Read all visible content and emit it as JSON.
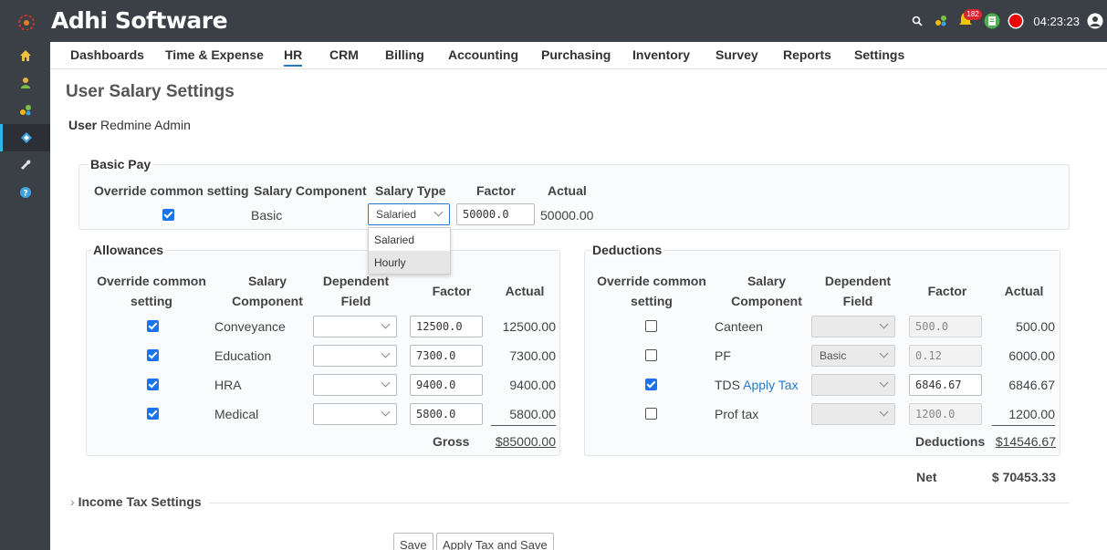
{
  "app": {
    "title": "Adhi Software",
    "notification_count": "182",
    "clock": "04:23:23"
  },
  "menu": [
    "Dashboards",
    "Time & Expense",
    "HR",
    "CRM",
    "Billing",
    "Accounting",
    "Purchasing",
    "Inventory",
    "Survey",
    "Reports",
    "Settings"
  ],
  "page": {
    "title": "User Salary Settings",
    "user_label": "User",
    "user_value": "Redmine Admin"
  },
  "basic_pay": {
    "legend": "Basic Pay",
    "headers": {
      "override": "Override common setting",
      "component": "Salary Component",
      "type": "Salary Type",
      "factor": "Factor",
      "actual": "Actual"
    },
    "row": {
      "checked": true,
      "component": "Basic",
      "salary_type": "Salaried",
      "factor": "50000.0",
      "actual": "50000.00"
    },
    "type_options": [
      "Salaried",
      "Hourly"
    ]
  },
  "allowances": {
    "legend": "Allowances",
    "headers": {
      "override_1": "Override common",
      "override_2": "setting",
      "component_1": "Salary",
      "component_2": "Component",
      "dep_1": "Dependent",
      "dep_2": "Field",
      "factor": "Factor",
      "actual": "Actual"
    },
    "rows": [
      {
        "checked": true,
        "component": "Conveyance",
        "factor": "12500.0",
        "actual": "12500.00"
      },
      {
        "checked": true,
        "component": "Education",
        "factor": "7300.0",
        "actual": "7300.00"
      },
      {
        "checked": true,
        "component": "HRA",
        "factor": "9400.0",
        "actual": "9400.00"
      },
      {
        "checked": true,
        "component": "Medical",
        "factor": "5800.0",
        "actual": "5800.00"
      }
    ],
    "total_label": "Gross",
    "total_value": "$85000.00"
  },
  "deductions": {
    "legend": "Deductions",
    "headers": {
      "override_1": "Override common",
      "override_2": "setting",
      "component_1": "Salary",
      "component_2": "Component",
      "dep_1": "Dependent",
      "dep_2": "Field",
      "factor": "Factor",
      "actual": "Actual"
    },
    "rows": [
      {
        "checked": false,
        "component": "Canteen",
        "dependent": "",
        "factor": "500.0",
        "actual": "500.00"
      },
      {
        "checked": false,
        "component": "PF",
        "dependent": "Basic",
        "factor": "0.12",
        "actual": "6000.00"
      },
      {
        "checked": true,
        "component": "TDS",
        "link": "Apply Tax",
        "dependent": "",
        "factor": "6846.67",
        "actual": "6846.67"
      },
      {
        "checked": false,
        "component": "Prof tax",
        "dependent": "",
        "factor": "1200.0",
        "actual": "1200.00"
      }
    ],
    "total_label": "Deductions",
    "total_value": "$14546.67"
  },
  "net": {
    "label": "Net",
    "value": "$ 70453.33"
  },
  "income_tax": {
    "label": "Income Tax Settings"
  },
  "buttons": {
    "save": "Save",
    "apply_tax_save": "Apply Tax and Save"
  },
  "colors": {
    "topbar": "#3b4047",
    "accent": "#2878c8",
    "checkbox": "#1a73e8",
    "badge": "#d9262e"
  }
}
